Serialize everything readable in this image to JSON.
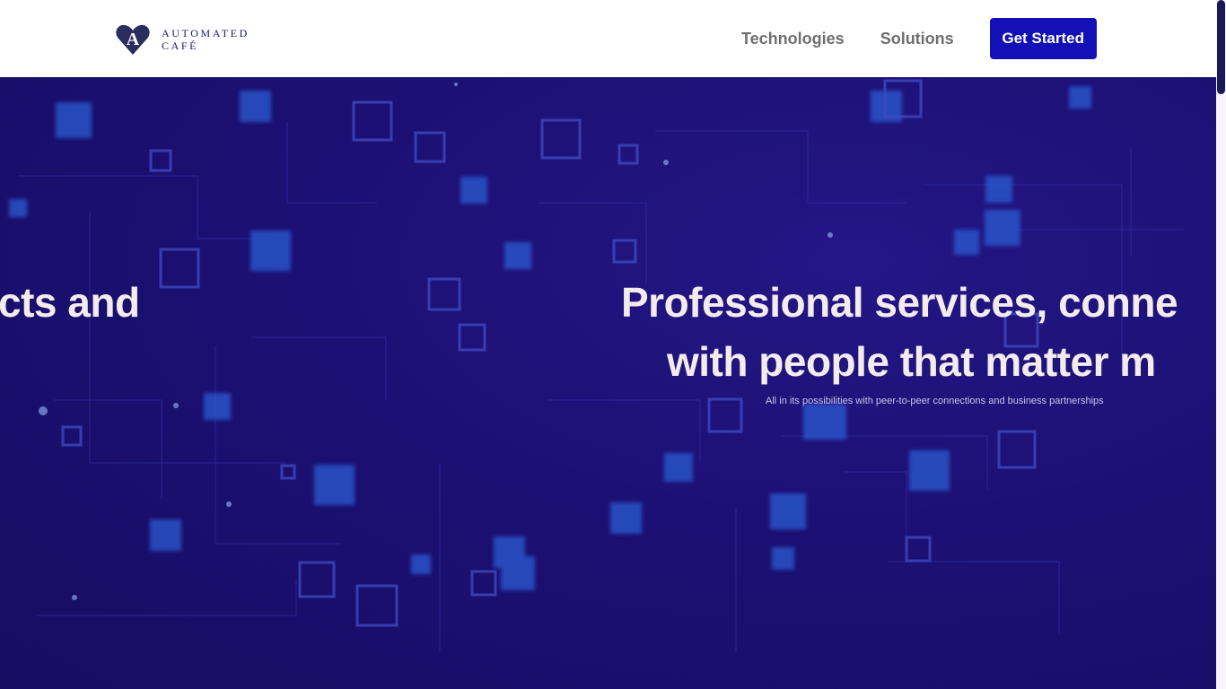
{
  "brand": {
    "line1": "AUTOMATED",
    "line2": "CAFÉ",
    "logo_icon": "heart-a-logo-icon",
    "color": "#1a1a70"
  },
  "nav": {
    "items": [
      {
        "label": "Technologies"
      },
      {
        "label": "Solutions"
      }
    ],
    "cta_label": "Get Started",
    "cta_color": "#1210b6"
  },
  "hero": {
    "slide_prev_text": "cts and",
    "slide_current_line1": "Professional services, conne",
    "slide_current_line2": "with people that matter m",
    "subtitle": "All in its possibilities with peer-to-peer connections and business partnerships",
    "background_color": "#1a0f6e",
    "text_color": "#f3ecec"
  }
}
